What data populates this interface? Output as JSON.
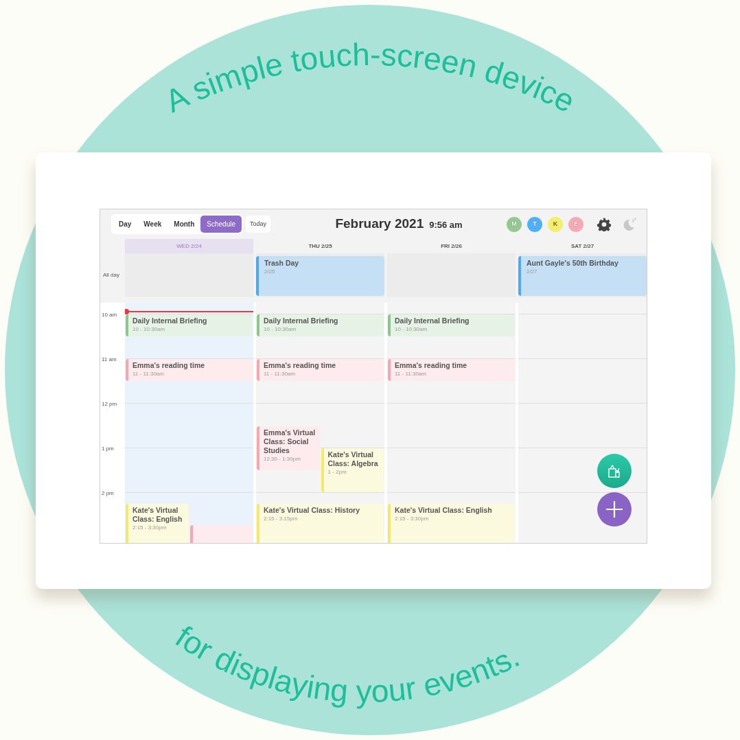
{
  "tagline_top": "A simple touch-screen device",
  "tagline_bottom": "for displaying your events.",
  "views": [
    {
      "label": "Day",
      "selected": false
    },
    {
      "label": "Week",
      "selected": false
    },
    {
      "label": "Month",
      "selected": false
    },
    {
      "label": "Schedule",
      "selected": true
    }
  ],
  "today_button": "Today",
  "title": "February 2021",
  "clock": "9:56 am",
  "members": [
    {
      "initial": "M",
      "color": "#93c98e"
    },
    {
      "initial": "T",
      "color": "#4fb0fa"
    },
    {
      "initial": "K",
      "color": "#f3ee6c"
    },
    {
      "initial": "E",
      "color": "#f9a9b4"
    }
  ],
  "all_day_label": "All day",
  "hours": [
    "10 am",
    "11 am",
    "12 pm",
    "1 pm",
    "2 pm"
  ],
  "now_line": true,
  "days": [
    {
      "label": "WED 2/24",
      "selected": true,
      "events": [
        {
          "title": "Daily Internal Briefing",
          "time": "10 - 10:30am",
          "color": "#8cc68a"
        },
        {
          "title": "Emma's reading time",
          "time": "11 - 11:30am",
          "color": "#f7a6b0"
        },
        {
          "title": "Kate's Virtual Class: English",
          "time": "2:15 - 3:30pm",
          "color": "#f3e96a"
        },
        {
          "color": "#f7a6b0"
        }
      ]
    },
    {
      "label": "THU 2/25",
      "selected": false,
      "all_day": [
        {
          "title": "Trash Day",
          "date": "2/25",
          "color": "#4da9f5"
        }
      ],
      "events": [
        {
          "title": "Daily Internal Briefing",
          "time": "10 - 10:30am",
          "color": "#8cc68a"
        },
        {
          "title": "Emma's reading time",
          "time": "11 - 11:30am",
          "color": "#f7a6b0"
        },
        {
          "title": "Emma's Virtual Class: Social Studies",
          "time": "12:30 - 1:30pm",
          "color": "#f7a6b0"
        },
        {
          "title": "Kate's Virtual Class: Algebra",
          "time": "1 - 2pm",
          "color": "#f3e96a"
        },
        {
          "title": "Kate's Virtual Class: History",
          "time": "2:15 - 3:15pm",
          "color": "#f3e96a"
        }
      ]
    },
    {
      "label": "FRI 2/26",
      "selected": false,
      "events": [
        {
          "title": "Daily Internal Briefing",
          "time": "10 - 10:30am",
          "color": "#8cc68a"
        },
        {
          "title": "Emma's reading time",
          "time": "11 - 11:30am",
          "color": "#f7a6b0"
        },
        {
          "title": "Kate's Virtual Class: English",
          "time": "2:15 - 3:30pm",
          "color": "#f3e96a"
        }
      ]
    },
    {
      "label": "SAT 2/27",
      "selected": false,
      "all_day": [
        {
          "title": "Aunt Gayle's 50th Birthday",
          "date": "2/27",
          "color": "#4da9f5"
        }
      ]
    }
  ]
}
